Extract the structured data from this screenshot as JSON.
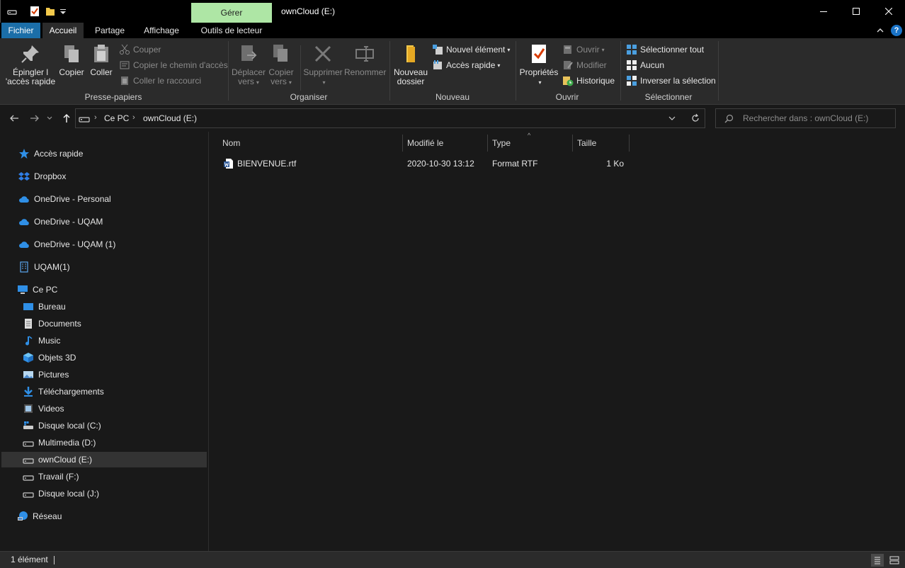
{
  "titlebar": {
    "manage_tab": "Gérer",
    "window_title": "ownCloud (E:)"
  },
  "tabs": {
    "file": "Fichier",
    "home": "Accueil",
    "share": "Partage",
    "view": "Affichage",
    "drive_tools": "Outils de lecteur"
  },
  "ribbon": {
    "clipboard": {
      "pin": "Épingler l",
      "pin2": "'accès rapide",
      "copy": "Copier",
      "paste": "Coller",
      "cut": "Couper",
      "copy_path": "Copier le chemin d'accès",
      "paste_shortcut": "Coller le raccourci",
      "label": "Presse-papiers"
    },
    "organize": {
      "move": "Déplacer",
      "move2": "vers",
      "copy": "Copier",
      "copy2": "vers",
      "delete": "Supprimer",
      "rename": "Renommer",
      "label": "Organiser"
    },
    "new": {
      "new_folder": "Nouveau",
      "new_folder2": "dossier",
      "new_item": "Nouvel élément",
      "easy_access": "Accès rapide",
      "label": "Nouveau"
    },
    "open": {
      "properties": "Propriétés",
      "open": "Ouvrir",
      "edit": "Modifier",
      "history": "Historique",
      "label": "Ouvrir"
    },
    "select": {
      "select_all": "Sélectionner tout",
      "select_none": "Aucun",
      "invert": "Inverser la sélection",
      "label": "Sélectionner"
    }
  },
  "address": {
    "crumbs": [
      "Ce PC",
      "ownCloud (E:)"
    ],
    "search_placeholder": "Rechercher dans : ownCloud (E:)"
  },
  "nav": {
    "items": [
      {
        "label": "Accès rapide",
        "icon": "star-icon"
      },
      {
        "label": "Dropbox",
        "icon": "dropbox-icon"
      },
      {
        "label": "OneDrive - Personal",
        "icon": "cloud-icon"
      },
      {
        "label": "OneDrive - UQAM",
        "icon": "cloud-icon"
      },
      {
        "label": "OneDrive - UQAM (1)",
        "icon": "cloud-icon"
      },
      {
        "label": "UQAM(1)",
        "icon": "building-icon"
      },
      {
        "label": "Ce PC",
        "icon": "computer-icon"
      },
      {
        "label": "Bureau",
        "icon": "desktop-icon"
      },
      {
        "label": "Documents",
        "icon": "documents-icon"
      },
      {
        "label": "Music",
        "icon": "music-icon"
      },
      {
        "label": "Objets 3D",
        "icon": "cube-icon"
      },
      {
        "label": "Pictures",
        "icon": "pictures-icon"
      },
      {
        "label": "Téléchargements",
        "icon": "download-icon"
      },
      {
        "label": "Videos",
        "icon": "video-icon"
      },
      {
        "label": "Disque local (C:)",
        "icon": "system-drive-icon"
      },
      {
        "label": "Multimedia (D:)",
        "icon": "drive-icon"
      },
      {
        "label": "ownCloud (E:)",
        "icon": "drive-icon"
      },
      {
        "label": "Travail (F:)",
        "icon": "drive-icon"
      },
      {
        "label": "Disque local (J:)",
        "icon": "drive-icon"
      },
      {
        "label": "Réseau",
        "icon": "network-icon"
      }
    ]
  },
  "filelist": {
    "columns": {
      "name": "Nom",
      "modified": "Modifié le",
      "type": "Type",
      "size": "Taille"
    },
    "rows": [
      {
        "name": "BIENVENUE.rtf",
        "modified": "2020-10-30 13:12",
        "type": "Format RTF",
        "size": "1 Ko"
      }
    ]
  },
  "status": {
    "count": "1 élément"
  },
  "colors": {
    "accent": "#1b6ea8",
    "manage_tab": "#aee6a5",
    "background": "#191919",
    "ribbon": "#2b2b2b"
  }
}
